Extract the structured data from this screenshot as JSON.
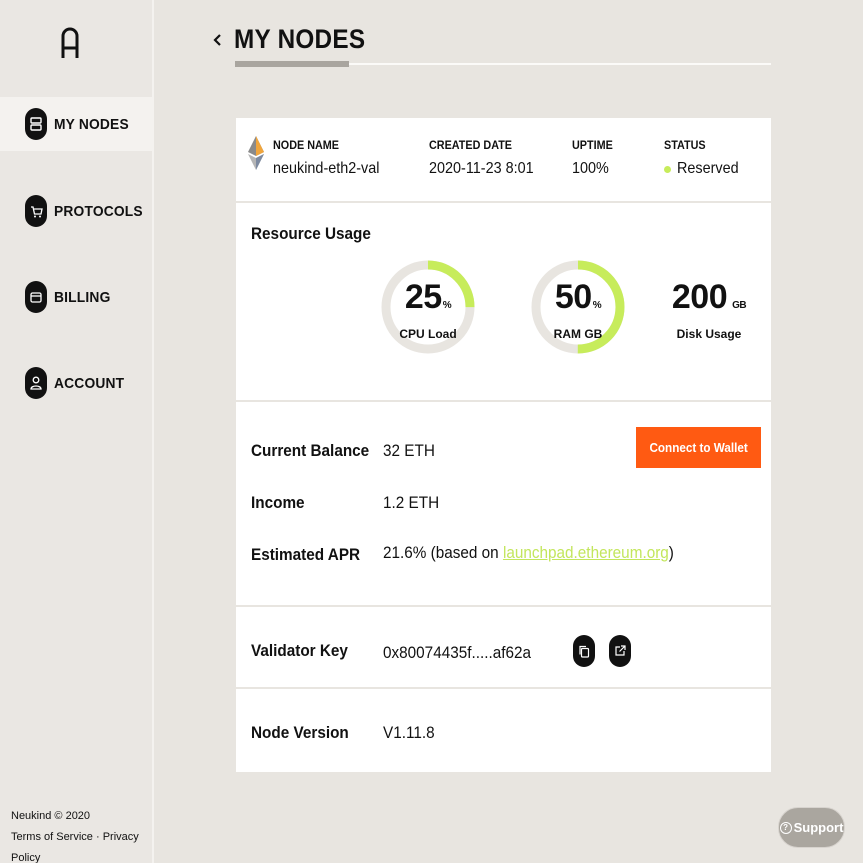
{
  "sidebar": {
    "items": [
      {
        "label": "MY NODES",
        "icon": "server-icon"
      },
      {
        "label": "PROTOCOLS",
        "icon": "cart-icon"
      },
      {
        "label": "BILLING",
        "icon": "wallet-icon"
      },
      {
        "label": "ACCOUNT",
        "icon": "user-icon"
      }
    ],
    "footer": {
      "copyright": "Neukind © 2020",
      "terms": "Terms of Service",
      "separator": "·",
      "privacy": "Privacy Policy"
    }
  },
  "header": {
    "title": "MY NODES"
  },
  "node": {
    "columns": {
      "name_label": "NODE NAME",
      "name": "neukind-eth2-val",
      "created_label": "CREATED DATE",
      "created": "2020-11-23 8:01",
      "uptime_label": "UPTIME",
      "uptime": "100%",
      "status_label": "STATUS",
      "status": "Reserved"
    }
  },
  "resources": {
    "title": "Resource Usage",
    "cpu": {
      "value": "25",
      "unit": "%",
      "caption": "CPU Load",
      "fraction": 0.25
    },
    "ram": {
      "value": "50",
      "unit": "%",
      "caption": "RAM GB",
      "fraction": 0.5
    },
    "disk": {
      "value": "200",
      "unit": "GB",
      "caption": "Disk Usage"
    }
  },
  "balance": {
    "current_label": "Current Balance",
    "current_value": "32 ETH",
    "income_label": "Income",
    "income_value": "1.2 ETH",
    "apr_label": "Estimated APR",
    "apr_prefix": "21.6% (based on ",
    "apr_link": "launchpad.ethereum.org",
    "apr_suffix": ")",
    "wallet_button": "Connect to Wallet"
  },
  "validator": {
    "label": "Validator Key",
    "value": "0x80074435f.....af62a"
  },
  "version": {
    "label": "Node Version",
    "value": "V1.11.8"
  },
  "support": {
    "label": "Support"
  },
  "colors": {
    "accent_green": "#c7ec5b",
    "accent_orange": "#ff5a12",
    "background": "#e8e5e0",
    "track": "#e8e5e0"
  }
}
